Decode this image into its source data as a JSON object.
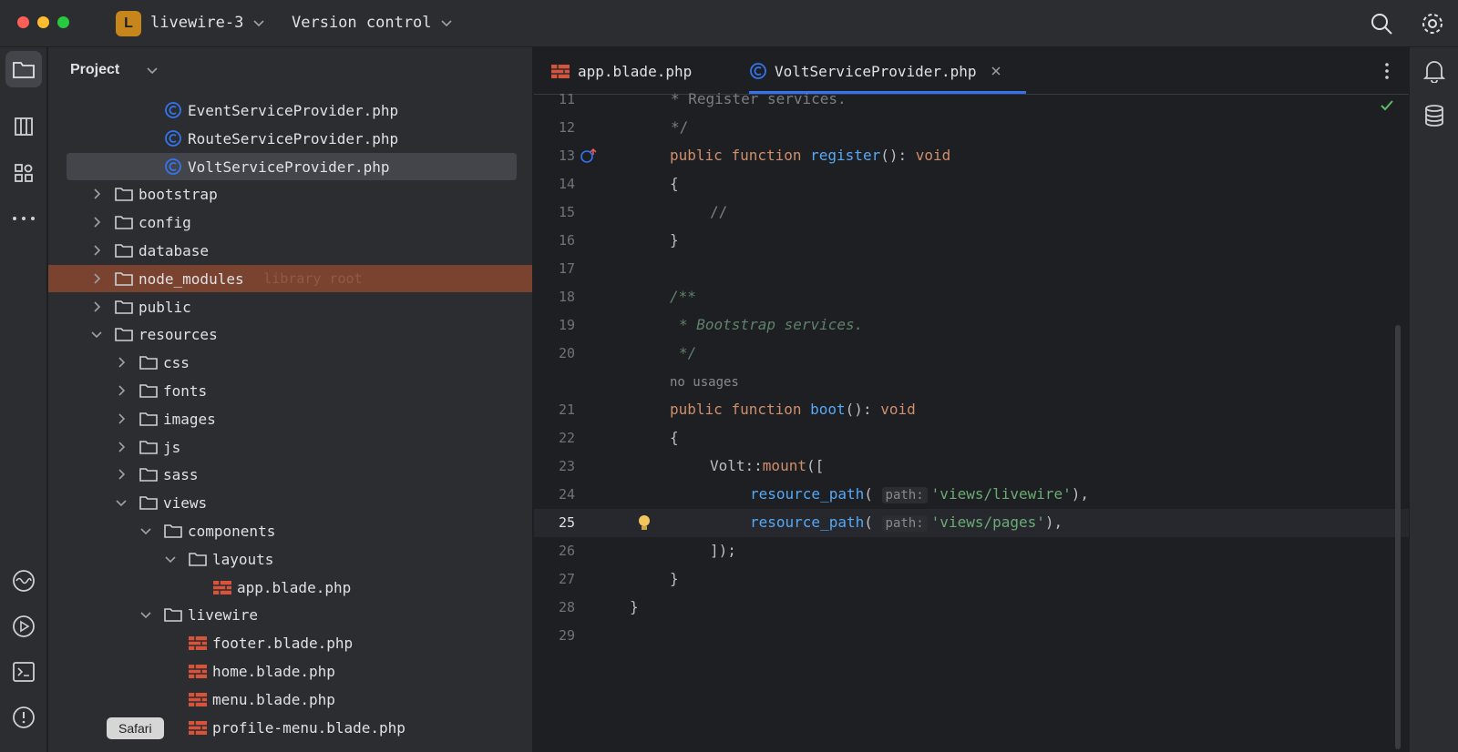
{
  "titlebar": {
    "project_badge": "L",
    "project_name": "livewire-3",
    "version_control": "Version control",
    "badge_color": "#c7861b"
  },
  "panel": {
    "title": "Project",
    "tree": [
      {
        "label": "EventServiceProvider.php",
        "type": "php-class"
      },
      {
        "label": "RouteServiceProvider.php",
        "type": "php-class"
      },
      {
        "label": "VoltServiceProvider.php",
        "type": "php-class",
        "selected": true
      },
      {
        "label": "bootstrap",
        "type": "folder",
        "expanded": false
      },
      {
        "label": "config",
        "type": "folder",
        "expanded": false
      },
      {
        "label": "database",
        "type": "folder",
        "expanded": false
      },
      {
        "label": "node_modules",
        "type": "folder",
        "expanded": false,
        "hint": "library root"
      },
      {
        "label": "public",
        "type": "folder",
        "expanded": false
      },
      {
        "label": "resources",
        "type": "folder",
        "expanded": true
      },
      {
        "label": "css",
        "type": "folder",
        "expanded": false
      },
      {
        "label": "fonts",
        "type": "folder",
        "expanded": false
      },
      {
        "label": "images",
        "type": "folder",
        "expanded": false
      },
      {
        "label": "js",
        "type": "folder",
        "expanded": false
      },
      {
        "label": "sass",
        "type": "folder",
        "expanded": false
      },
      {
        "label": "views",
        "type": "folder",
        "expanded": true
      },
      {
        "label": "components",
        "type": "folder",
        "expanded": true
      },
      {
        "label": "layouts",
        "type": "folder",
        "expanded": true
      },
      {
        "label": "app.blade.php",
        "type": "blade"
      },
      {
        "label": "livewire",
        "type": "folder",
        "expanded": true
      },
      {
        "label": "footer.blade.php",
        "type": "blade"
      },
      {
        "label": "home.blade.php",
        "type": "blade"
      },
      {
        "label": "menu.blade.php",
        "type": "blade"
      },
      {
        "label": "profile-menu.blade.php",
        "type": "blade"
      }
    ]
  },
  "tabs": [
    {
      "label": "app.blade.php",
      "icon": "blade-icon"
    },
    {
      "label": "VoltServiceProvider.php",
      "icon": "php-class-icon",
      "active": true
    }
  ],
  "editor": {
    "current_line": 25,
    "lines": [
      {
        "n": "11",
        "text": " * Register services."
      },
      {
        "n": "12",
        "text": " */"
      },
      {
        "n": "13",
        "text": "public function register(): void"
      },
      {
        "n": "14",
        "text": "{"
      },
      {
        "n": "15",
        "text": "//"
      },
      {
        "n": "16",
        "text": "}"
      },
      {
        "n": "17",
        "text": ""
      },
      {
        "n": "18",
        "text": "/**"
      },
      {
        "n": "19",
        "text": " * Bootstrap services."
      },
      {
        "n": "20",
        "text": " */"
      },
      {
        "n": "",
        "text": "no usages"
      },
      {
        "n": "21",
        "text": "public function boot(): void"
      },
      {
        "n": "22",
        "text": "{"
      },
      {
        "n": "23",
        "text": "Volt::mount(["
      },
      {
        "n": "24",
        "text": "resource_path( path: 'views/livewire'),"
      },
      {
        "n": "25",
        "text": "resource_path( path: 'views/pages'),"
      },
      {
        "n": "26",
        "text": "]);"
      },
      {
        "n": "27",
        "text": "}"
      },
      {
        "n": "28",
        "text": "}"
      },
      {
        "n": "29",
        "text": ""
      }
    ],
    "tokens": {
      "kw_public": "public",
      "kw_function": "function",
      "kw_void": "void",
      "fn_register": "register",
      "fn_boot": "boot",
      "paren_colon": "():",
      "comment_register": "* Register services.",
      "comment_end": "*/",
      "comment_slash": "//",
      "doc_start": "/**",
      "doc_bootstrap": "* Bootstrap services.",
      "volt": "Volt::",
      "mount": "mount",
      "mount_open": "([",
      "resource_path": "resource_path",
      "open_paren": "(",
      "param_hint": "path:",
      "str_livewire": "'views/livewire'",
      "str_pages": "'views/pages'",
      "close_comma": "),",
      "close_mount": "]);",
      "brace_open": "{",
      "brace_close": "}",
      "usages": "no usages"
    }
  },
  "tooltip": {
    "label": "Safari"
  },
  "colors": {
    "keyword": "#cf8e6d",
    "function": "#56a8f5",
    "string": "#6aab73",
    "doc_comment": "#5f826b",
    "accent": "#3574f0",
    "excluded_bg": "#7a4330"
  }
}
